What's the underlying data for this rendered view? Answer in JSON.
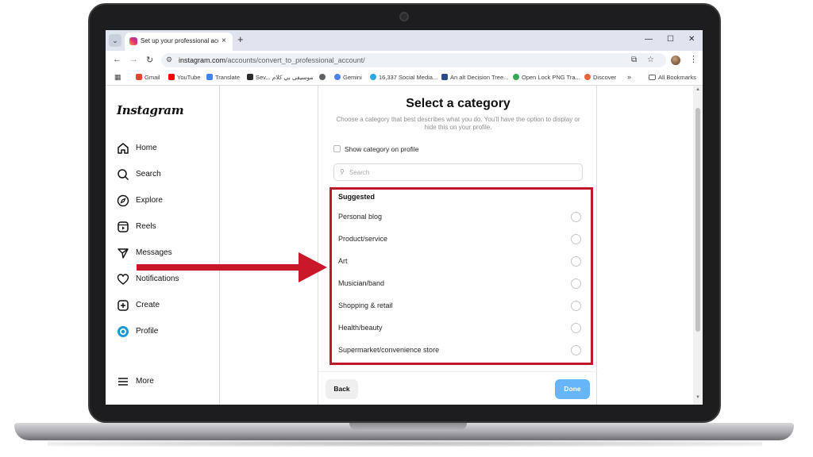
{
  "browser": {
    "tab_title": "Set up your professional account",
    "tab_menu_glyph": "⌄",
    "tab_close": "×",
    "new_tab": "+",
    "window_controls": [
      "—",
      "☐",
      "✕"
    ],
    "url_host": "instagram.com",
    "url_path": "/accounts/convert_to_professional_account/",
    "bookmarks": [
      {
        "label": "Gmail",
        "color": "#ea4335"
      },
      {
        "label": "YouTube",
        "color": "#ff0000"
      },
      {
        "label": "Translate",
        "color": "#4285f4"
      },
      {
        "label": "Sev...",
        "color": "#2b2b2b"
      },
      {
        "label": "موسيقى بي كلام",
        "color": "#ffffff"
      },
      {
        "label": "",
        "color": "#5f6368"
      },
      {
        "label": "Gemini",
        "color": "#4b82f0"
      },
      {
        "label": "16,337 Social Media...",
        "color": "#2aa8e0"
      },
      {
        "label": "An alt Decision Tree...",
        "color": "#2a4a8a"
      },
      {
        "label": "Open Lock PNG Tra...",
        "color": "#34a853"
      },
      {
        "label": "Discover",
        "color": "#e8643a"
      }
    ],
    "bookmarks_overflow": "»",
    "all_bookmarks": "All Bookmarks"
  },
  "sidebar": {
    "logo": "Instagram",
    "items": [
      {
        "label": "Home",
        "icon": "home-icon"
      },
      {
        "label": "Search",
        "icon": "search-icon"
      },
      {
        "label": "Explore",
        "icon": "compass-icon"
      },
      {
        "label": "Reels",
        "icon": "reels-icon"
      },
      {
        "label": "Messages",
        "icon": "send-icon"
      },
      {
        "label": "Notifications",
        "icon": "heart-icon"
      },
      {
        "label": "Create",
        "icon": "plus-square-icon"
      },
      {
        "label": "Profile",
        "icon": "profile-icon"
      }
    ],
    "more": "More"
  },
  "category": {
    "title": "Select a category",
    "description": "Choose a category that best describes what you do. You'll have the option to display or hide this on your profile.",
    "show_category_label": "Show category on profile",
    "show_category_checked": false,
    "search_placeholder": "Search",
    "suggested_label": "Suggested",
    "options": [
      "Personal blog",
      "Product/service",
      "Art",
      "Musician/band",
      "Shopping & retail",
      "Health/beauty",
      "Supermarket/convenience store"
    ],
    "back_label": "Back",
    "done_label": "Done"
  },
  "colors": {
    "highlight": "#c0172b",
    "done_button": "#67b5f9",
    "arrow": "#c8182a"
  }
}
